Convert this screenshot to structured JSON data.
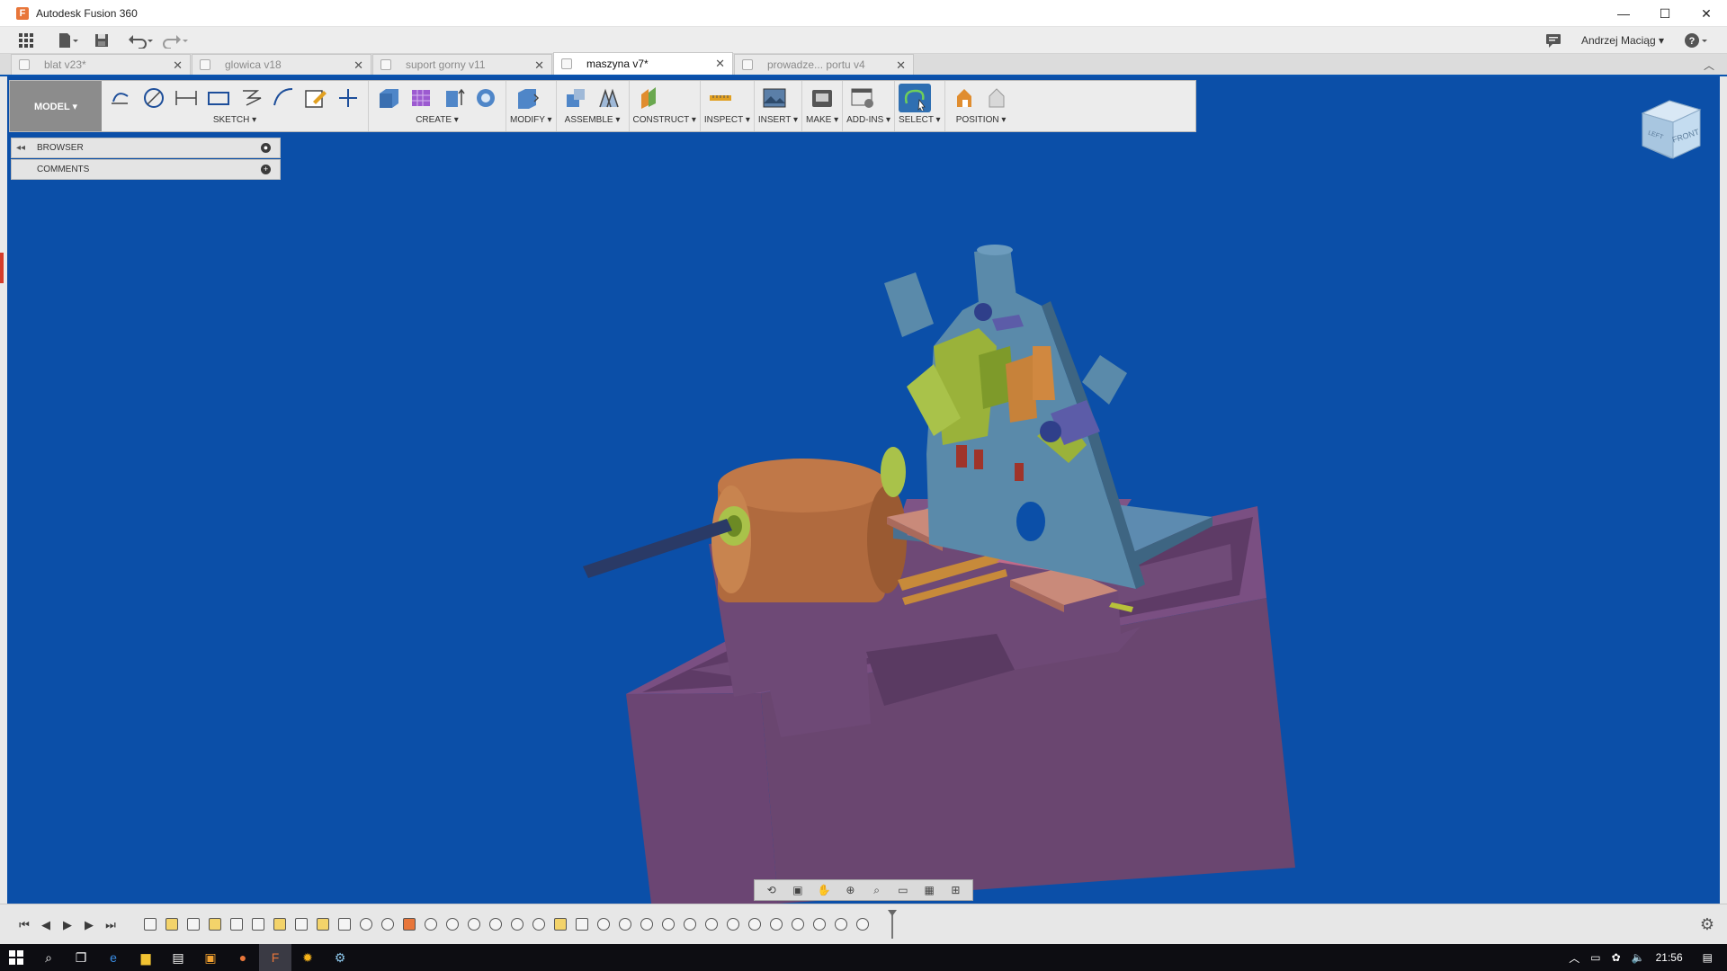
{
  "window": {
    "title": "Autodesk Fusion 360",
    "app_icon": "F"
  },
  "qat": {
    "user": "Andrzej Maciąg ▾"
  },
  "tabs": [
    {
      "label": "blat v23*",
      "active": false
    },
    {
      "label": "glowica v18",
      "active": false
    },
    {
      "label": "suport gorny v11",
      "active": false
    },
    {
      "label": "maszyna v7*",
      "active": true
    },
    {
      "label": "prowadze... portu v4",
      "active": false
    }
  ],
  "ribbon": {
    "workspace": "MODEL ▾",
    "groups": {
      "sketch": "SKETCH ▾",
      "create": "CREATE ▾",
      "modify": "MODIFY ▾",
      "assemble": "ASSEMBLE ▾",
      "construct": "CONSTRUCT ▾",
      "inspect": "INSPECT ▾",
      "insert": "INSERT ▾",
      "make": "MAKE ▾",
      "addins": "ADD-INS ▾",
      "select": "SELECT ▾",
      "position": "POSITION ▾"
    }
  },
  "browser": {
    "browser_label": "BROWSER",
    "comments_label": "COMMENTS"
  },
  "viewcube": {
    "front_label": "FRONT",
    "left_label": "LEFT"
  },
  "taskbar": {
    "time": "21:56"
  },
  "colors": {
    "viewport_bg": "#0b4fa8",
    "base_purple": "#6a4670",
    "spindle_orange": "#b06a3e",
    "plate_blue": "#5a8aaa",
    "accent_green": "#9ab23a"
  }
}
